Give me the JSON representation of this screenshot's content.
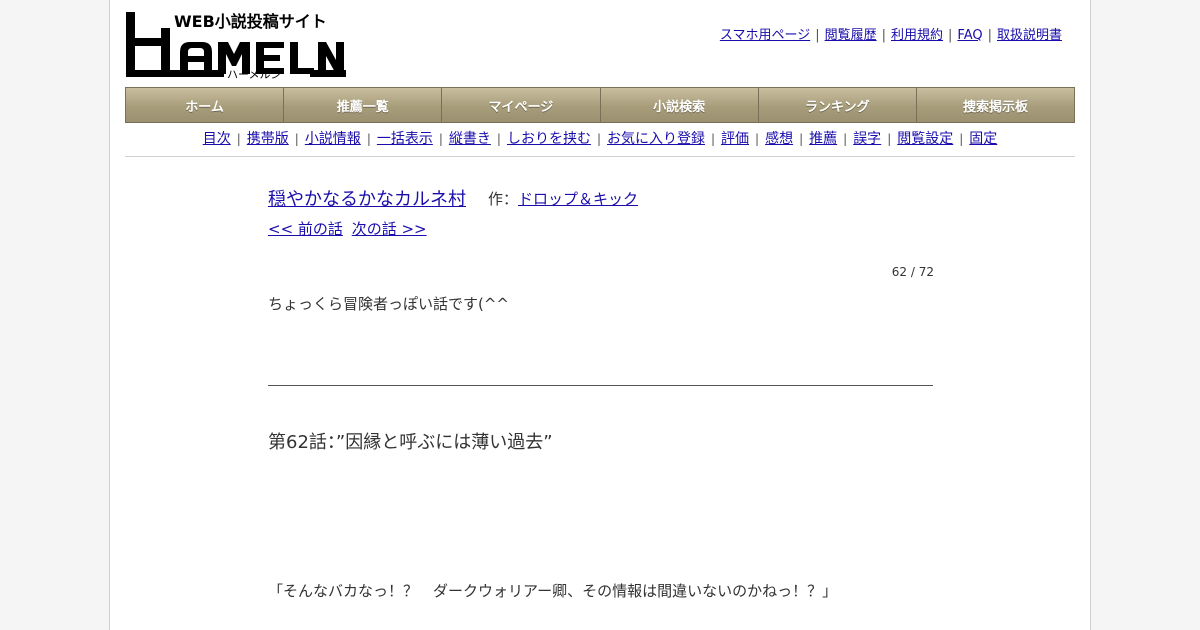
{
  "logo": {
    "tagline": "WEB小説投稿サイト",
    "wordmark": "HAMELN",
    "kana": "ハーメルン"
  },
  "top_links": [
    {
      "label": "スマホ用ページ"
    },
    {
      "label": "閲覧履歴"
    },
    {
      "label": "利用規約"
    },
    {
      "label": "FAQ"
    },
    {
      "label": "取扱説明書"
    }
  ],
  "nav": [
    {
      "label": "ホーム"
    },
    {
      "label": "推薦一覧"
    },
    {
      "label": "マイページ"
    },
    {
      "label": "小説検索"
    },
    {
      "label": "ランキング"
    },
    {
      "label": "捜索掲示板"
    }
  ],
  "sub_links": [
    {
      "label": "目次"
    },
    {
      "label": "携帯版"
    },
    {
      "label": "小説情報"
    },
    {
      "label": "一括表示"
    },
    {
      "label": "縦書き"
    },
    {
      "label": "しおりを挟む"
    },
    {
      "label": "お気に入り登録"
    },
    {
      "label": "評価"
    },
    {
      "label": "感想"
    },
    {
      "label": "推薦"
    },
    {
      "label": "誤字"
    },
    {
      "label": "閲覧設定"
    },
    {
      "label": "固定"
    }
  ],
  "separator": "|",
  "novel": {
    "title": "穏やかなるかなカルネ村",
    "author_prefix": "作：",
    "author": "ドロップ＆キック",
    "prev": "<< 前の話",
    "next": "次の話 >>",
    "counter": "62 / 72",
    "preface": "ちょっくら冒険者っぽい話です(^^",
    "chapter_title": "第62話：”因縁と呼ぶには薄い過去”",
    "first_line": "「そんなバカなっ！？　ダークウォリアー卿、その情報は間違いないのかねっ！？」"
  },
  "colors": {
    "link": "#1a0dab",
    "nav_bg": "#a79d7b",
    "nav_border": "#7a7058"
  }
}
